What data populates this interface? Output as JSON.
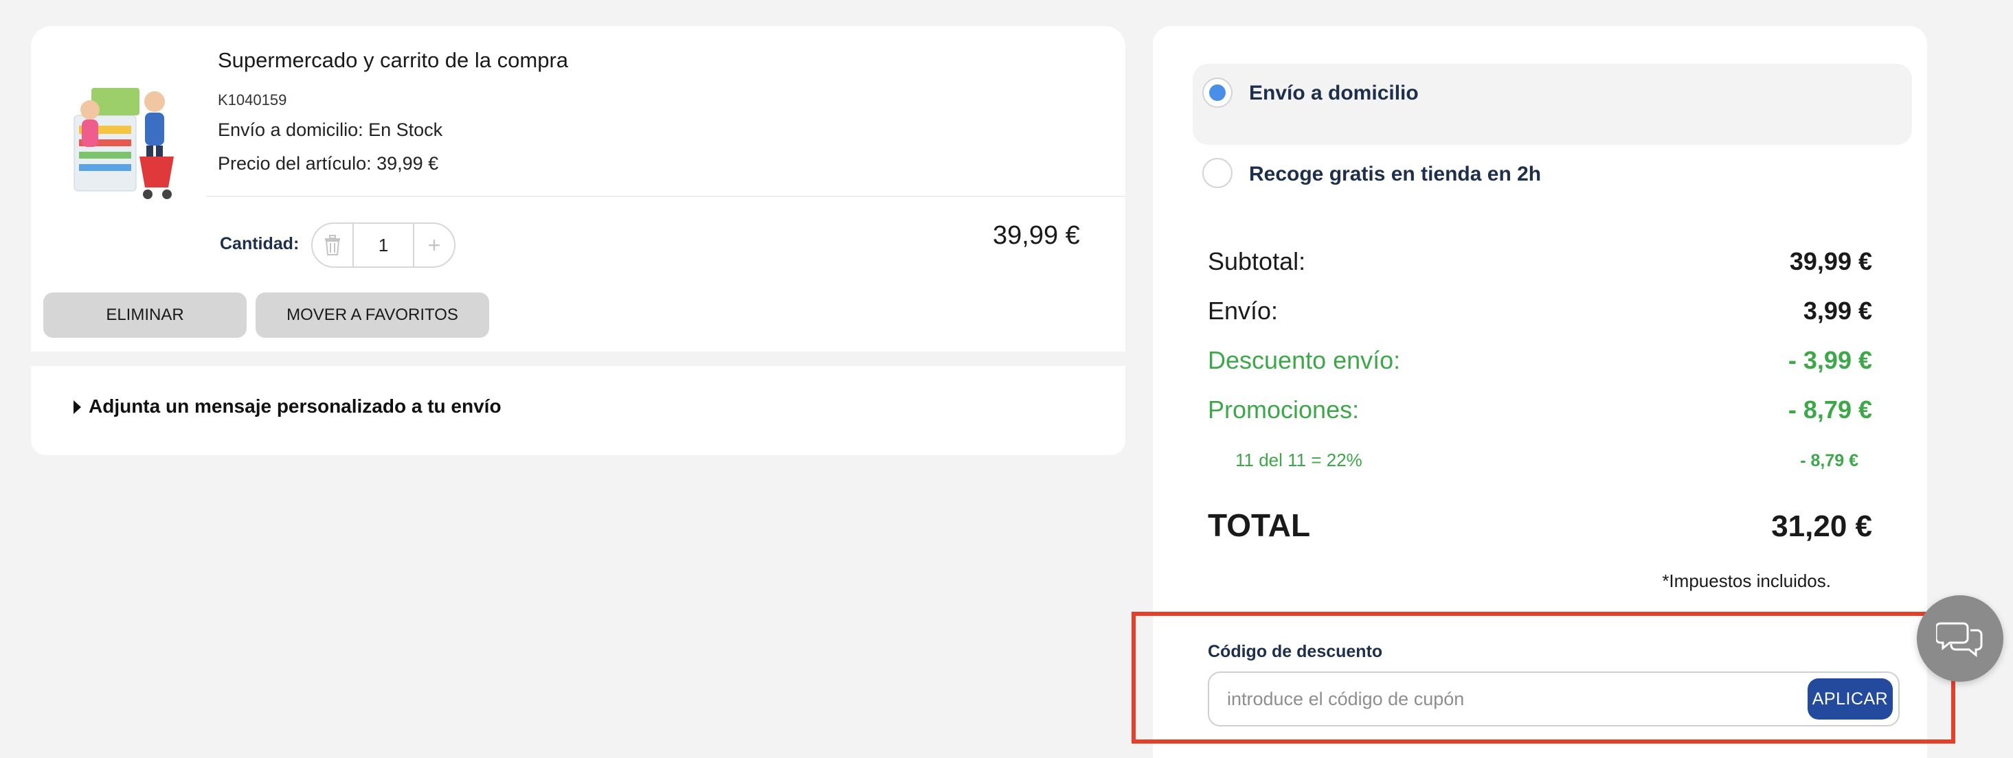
{
  "product": {
    "name": "Supermercado y carrito de la compra",
    "sku": "K1040159",
    "stock": "Envío a domicilio: En Stock",
    "unit_price": "Precio del artículo: 39,99 €",
    "quantity_label": "Cantidad:",
    "quantity": "1",
    "plus_symbol": "+",
    "line_total": "39,99 €",
    "image_icon": "product-thumbnail"
  },
  "actions": {
    "remove": "ELIMINAR",
    "move_to_favorites": "MOVER A FAVORITOS"
  },
  "gift_message": {
    "label": "Adjunta un mensaje personalizado a tu envío"
  },
  "delivery_options": [
    {
      "label": "Envío a domicilio",
      "selected": true
    },
    {
      "label": "Recoge gratis en tienda en 2h",
      "selected": false
    }
  ],
  "summary": {
    "subtotal_label": "Subtotal:",
    "subtotal_value": "39,99 €",
    "shipping_label": "Envío:",
    "shipping_value": "3,99 €",
    "shipping_discount_label": "Descuento envío:",
    "shipping_discount_value": "- 3,99 €",
    "promotions_label": "Promociones:",
    "promotions_value": "- 8,79 €",
    "promo_detail_label": "11 del 11 = 22%",
    "promo_detail_value": "- 8,79 €",
    "total_label": "TOTAL",
    "total_value": "31,20 €",
    "tax_note": "*Impuestos incluidos."
  },
  "coupon": {
    "title": "Código de descuento",
    "placeholder": "introduce el código de cupón",
    "apply_label": "APLICAR"
  },
  "colors": {
    "accent_blue": "#234a9c",
    "radio_selected": "#4a8fe7",
    "discount_green": "#3da74a",
    "highlight_red": "#e5402a"
  }
}
